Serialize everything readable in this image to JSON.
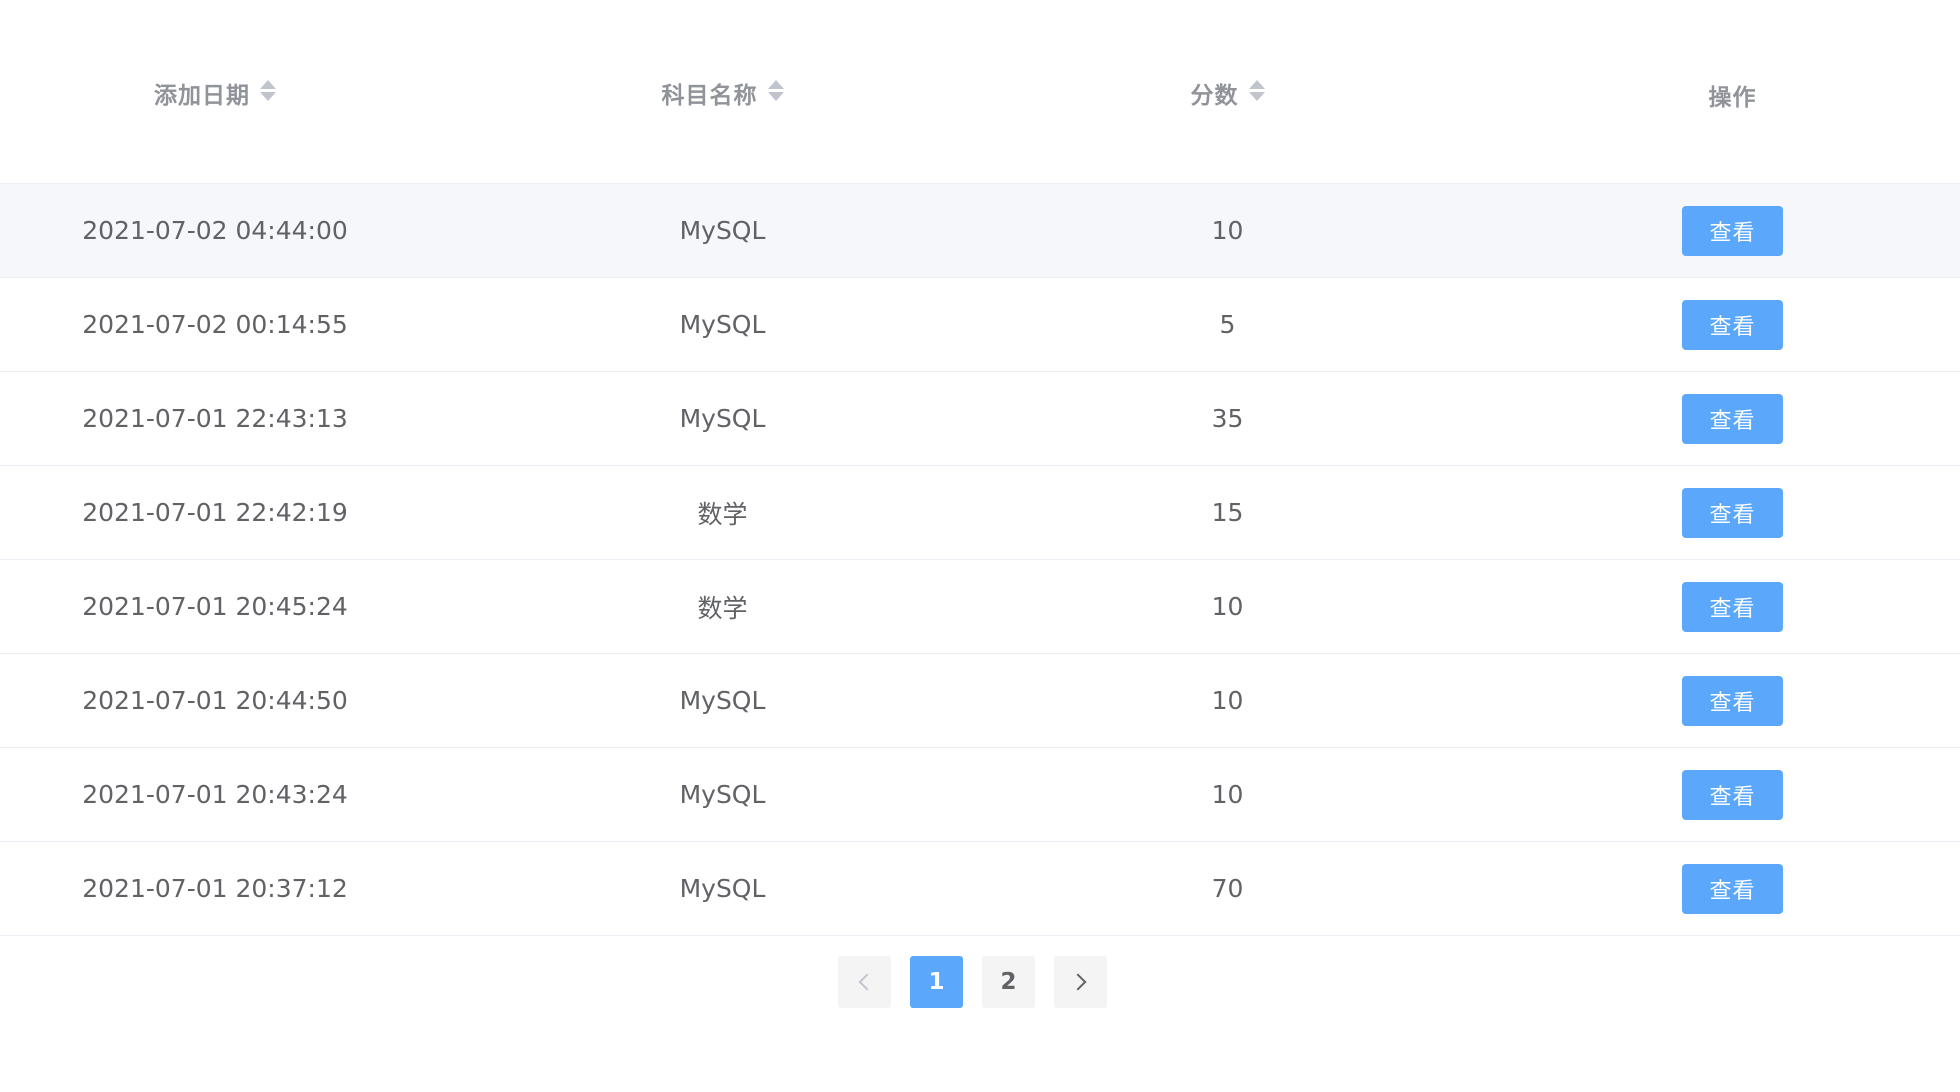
{
  "table": {
    "columns": [
      {
        "label": "添加日期",
        "sortable": true
      },
      {
        "label": "科目名称",
        "sortable": true
      },
      {
        "label": "分数",
        "sortable": true
      },
      {
        "label": "操作",
        "sortable": false
      }
    ],
    "rows": [
      {
        "date": "2021-07-02 04:44:00",
        "subject": "MySQL",
        "score": "10",
        "action": "查看"
      },
      {
        "date": "2021-07-02 00:14:55",
        "subject": "MySQL",
        "score": "5",
        "action": "查看"
      },
      {
        "date": "2021-07-01 22:43:13",
        "subject": "MySQL",
        "score": "35",
        "action": "查看"
      },
      {
        "date": "2021-07-01 22:42:19",
        "subject": "数学",
        "score": "15",
        "action": "查看"
      },
      {
        "date": "2021-07-01 20:45:24",
        "subject": "数学",
        "score": "10",
        "action": "查看"
      },
      {
        "date": "2021-07-01 20:44:50",
        "subject": "MySQL",
        "score": "10",
        "action": "查看"
      },
      {
        "date": "2021-07-01 20:43:24",
        "subject": "MySQL",
        "score": "10",
        "action": "查看"
      },
      {
        "date": "2021-07-01 20:37:12",
        "subject": "MySQL",
        "score": "70",
        "action": "查看"
      }
    ],
    "hovered_row": 0
  },
  "pagination": {
    "prev_icon": "chevron-left-icon",
    "next_icon": "chevron-right-icon",
    "pages": [
      "1",
      "2"
    ],
    "current_page": "1"
  },
  "colors": {
    "primary": "#5aa7fb",
    "header_text": "#909399",
    "body_text": "#606266",
    "row_hover": "#f5f7fa",
    "border": "#ebeef5"
  }
}
